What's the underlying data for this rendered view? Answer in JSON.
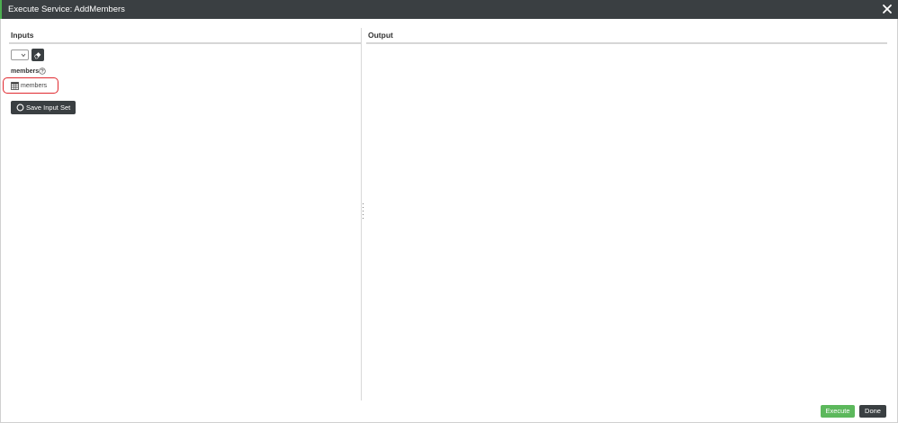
{
  "dialog": {
    "title": "Execute Service: AddMembers",
    "close_icon": "close-icon",
    "accent_color": "#4caf50",
    "titlebar_color": "#3a3f42"
  },
  "inputs": {
    "heading": "Inputs",
    "input_set_select": {
      "selected": "",
      "icon": "chevron-down-icon"
    },
    "clear_button_icon": "eraser-icon",
    "parameter": {
      "name": "members",
      "help_icon": "question-circle-icon",
      "field_icon": "table-icon",
      "field_label": "members",
      "highlight_color": "#e0292f"
    },
    "save_input_set_label": "Save Input Set",
    "save_icon": "circle-icon"
  },
  "output": {
    "heading": "Output"
  },
  "footer": {
    "execute_label": "Execute",
    "done_label": "Done",
    "execute_color": "#5cb85c"
  }
}
